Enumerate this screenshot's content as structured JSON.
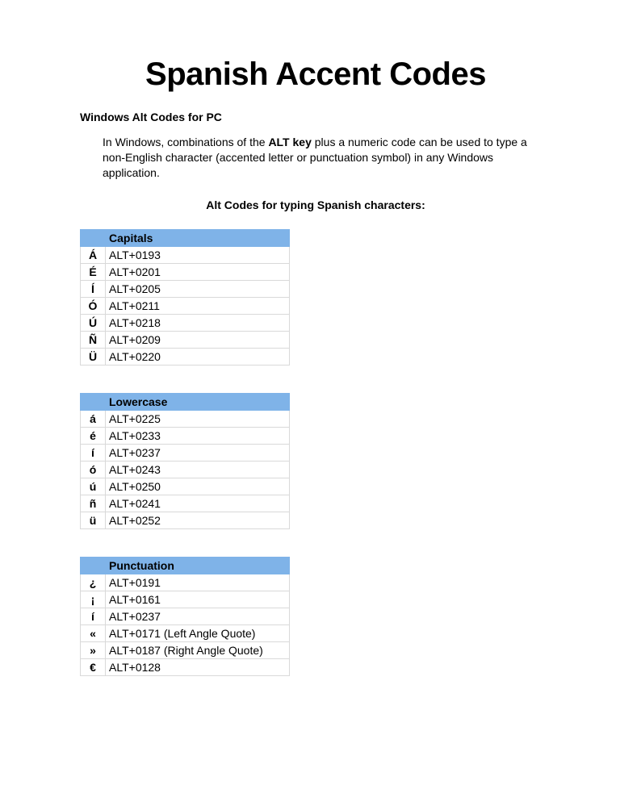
{
  "title": "Spanish Accent Codes",
  "section_title": "Windows Alt Codes for PC",
  "intro_prefix": "In Windows, combinations of the ",
  "intro_bold": "ALT key",
  "intro_suffix": " plus a numeric code can be used to type a non-English character (accented letter or punctuation symbol) in any Windows application.",
  "subhead": "Alt Codes for typing Spanish characters:",
  "tables": {
    "capitals": {
      "header": "Capitals",
      "rows": [
        {
          "char": "Á",
          "code": "ALT+0193"
        },
        {
          "char": "É",
          "code": "ALT+0201"
        },
        {
          "char": "Í",
          "code": "ALT+0205"
        },
        {
          "char": "Ó",
          "code": "ALT+0211"
        },
        {
          "char": "Ú",
          "code": "ALT+0218"
        },
        {
          "char": "Ñ",
          "code": "ALT+0209"
        },
        {
          "char": "Ü",
          "code": "ALT+0220"
        }
      ]
    },
    "lowercase": {
      "header": "Lowercase",
      "rows": [
        {
          "char": "á",
          "code": "ALT+0225"
        },
        {
          "char": "é",
          "code": "ALT+0233"
        },
        {
          "char": "í",
          "code": "ALT+0237"
        },
        {
          "char": "ó",
          "code": "ALT+0243"
        },
        {
          "char": "ú",
          "code": "ALT+0250"
        },
        {
          "char": "ñ",
          "code": "ALT+0241"
        },
        {
          "char": "ü",
          "code": "ALT+0252"
        }
      ]
    },
    "punctuation": {
      "header": "Punctuation",
      "rows": [
        {
          "char": "¿",
          "code": "ALT+0191"
        },
        {
          "char": "¡",
          "code": "ALT+0161"
        },
        {
          "char": "í",
          "code": "ALT+0237"
        },
        {
          "char": "«",
          "code": "ALT+0171 (Left Angle Quote)"
        },
        {
          "char": "»",
          "code": "ALT+0187 (Right Angle Quote)"
        },
        {
          "char": "€",
          "code": "ALT+0128"
        }
      ]
    }
  }
}
